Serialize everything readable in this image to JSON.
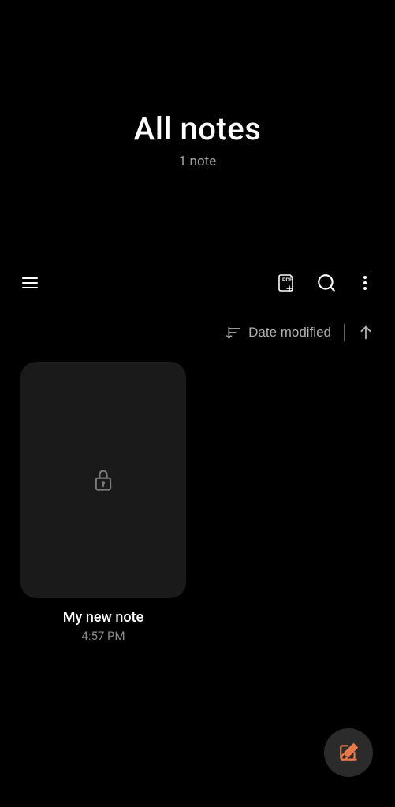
{
  "header": {
    "title": "All notes",
    "subtitle": "1 note"
  },
  "sort": {
    "label": "Date modified"
  },
  "notes": [
    {
      "title": "My new note",
      "time": "4:57 PM",
      "locked": true
    }
  ]
}
